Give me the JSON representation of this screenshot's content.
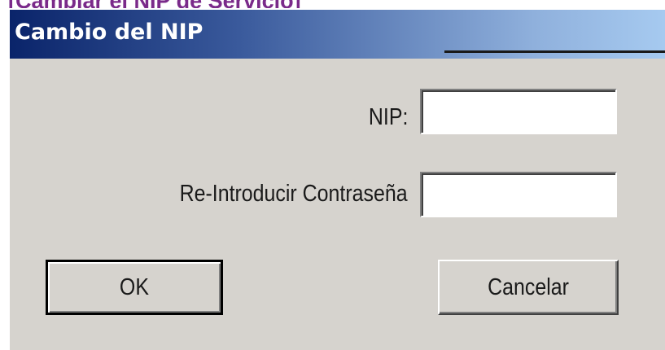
{
  "document": {
    "heading": "[Cambiar el NIP de Servicio]"
  },
  "dialog": {
    "title": "Cambio del NIP",
    "fields": {
      "nip_label": "NIP:",
      "nip_value": "",
      "reenter_label": "Re-Introducir Contraseña",
      "reenter_value": ""
    },
    "buttons": {
      "ok_label": "OK",
      "cancel_label": "Cancelar"
    }
  },
  "colors": {
    "heading": "#7a2a8a",
    "dialog_face": "#d6d3ce",
    "titlebar_start": "#0a246a",
    "titlebar_end": "#a6caf0"
  }
}
